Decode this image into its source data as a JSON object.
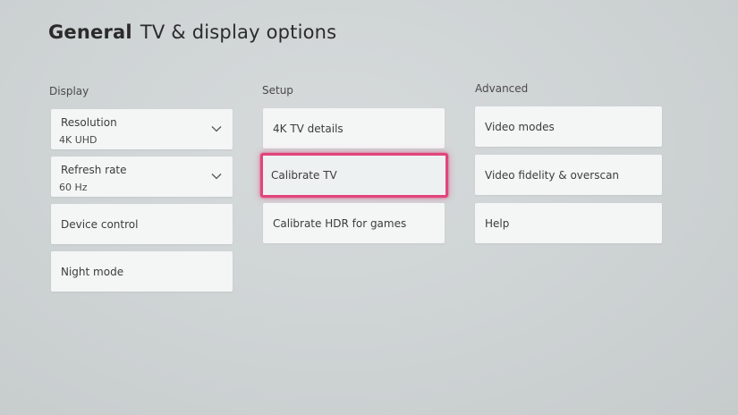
{
  "header": {
    "breadcrumb": "General",
    "title": "TV & display options"
  },
  "focus_color": "#e0457b",
  "columns": {
    "display": {
      "heading": "Display",
      "resolution": {
        "label": "Resolution",
        "value": "4K UHD",
        "icon": "chevron-down-icon"
      },
      "refresh_rate": {
        "label": "Refresh rate",
        "value": "60 Hz",
        "icon": "chevron-down-icon"
      },
      "device_control": {
        "label": "Device control"
      },
      "night_mode": {
        "label": "Night mode"
      }
    },
    "setup": {
      "heading": "Setup",
      "tv_details": {
        "label": "4K TV details"
      },
      "calibrate_tv": {
        "label": "Calibrate TV",
        "focused": true
      },
      "calibrate_hdr": {
        "label": "Calibrate HDR for games"
      }
    },
    "advanced": {
      "heading": "Advanced",
      "video_modes": {
        "label": "Video modes"
      },
      "video_fidelity": {
        "label": "Video fidelity & overscan"
      },
      "help": {
        "label": "Help"
      }
    }
  }
}
